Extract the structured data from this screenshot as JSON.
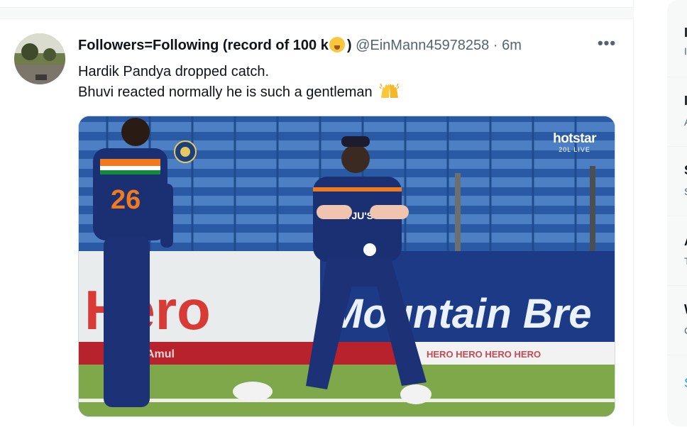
{
  "tweet": {
    "display_name": "Followers=Following (record of 100 k",
    "display_name_suffix": ")",
    "handle": "@EinMann45978258",
    "separator": "·",
    "time": "6m",
    "more_label": "•••",
    "text_line1": "Hardik Pandya dropped catch.",
    "text_line2": "Bhuvi reacted normally he is such a gentleman"
  },
  "media": {
    "jersey_number": "26",
    "shirt_sponsor": "BYJU'S",
    "board_text_left": "Hero",
    "board_text_right": "Mountain Bre",
    "bottom_board_left": "Amul",
    "bottom_board_right": "HERO  HERO  HERO  HERO",
    "watermark_brand": "hotstar",
    "watermark_live": "20L LIVE"
  },
  "colors": {
    "text_primary": "#0f1419",
    "text_secondary": "#536471",
    "link_blue": "#1d9bf0",
    "border": "#eff3f4"
  },
  "icons": [
    "more-icon",
    "sleepy-emoji-icon",
    "raising-hands-emoji-icon"
  ]
}
